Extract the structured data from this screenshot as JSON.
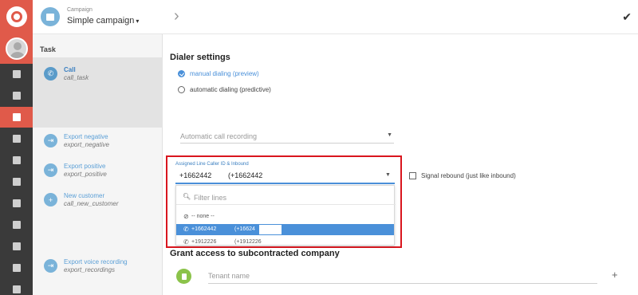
{
  "campaign": {
    "caption": "Campaign",
    "name": "Simple campaign",
    "caret": "▾"
  },
  "taskpanel": {
    "header": "Task",
    "items": [
      {
        "title": "Call",
        "subtitle": "call_task",
        "icon": "phone-icon"
      },
      {
        "title": "Export negative",
        "subtitle": "export_negative",
        "icon": "export-icon"
      },
      {
        "title": "Export positive",
        "subtitle": "export_positive",
        "icon": "export-icon"
      },
      {
        "title": "New customer",
        "subtitle": "call_new_customer",
        "icon": "plus-circle-icon"
      },
      {
        "title": "Export voice recording",
        "subtitle": "export_recordings",
        "icon": "export-icon"
      }
    ]
  },
  "topbar": {
    "chevron": "›",
    "check": "✔"
  },
  "dialer": {
    "title": "Dialer settings",
    "options": [
      {
        "label": "manual dialing (preview)",
        "checked": true
      },
      {
        "label": "automatic dialing (predictive)",
        "checked": false
      }
    ],
    "recording_placeholder": "Automatic call recording"
  },
  "caller_id": {
    "label": "Assigned Line Caller ID & Inbound",
    "value_number": "+1662442",
    "value_name": "(+1662442",
    "filter_placeholder": "Filter lines",
    "options": [
      {
        "icon": "⊘",
        "a": "-- none --",
        "b": "",
        "selected": false
      },
      {
        "icon": "✆",
        "a": "+1662442",
        "b": "(+16624",
        "selected": true
      },
      {
        "icon": "✆",
        "a": "+1912226",
        "b": "(+1912226",
        "selected": false
      }
    ]
  },
  "signal_rebound": {
    "label": "Signal rebound (just like inbound)",
    "checked": false
  },
  "grant": {
    "title": "Grant access to subcontracted company",
    "tenant_placeholder": "Tenant name",
    "add": "+"
  },
  "colors": {
    "accent": "#4a90d9",
    "brand": "#e05a4a",
    "highlight_box": "#d9161e",
    "tenant_icon": "#8bc34a"
  }
}
